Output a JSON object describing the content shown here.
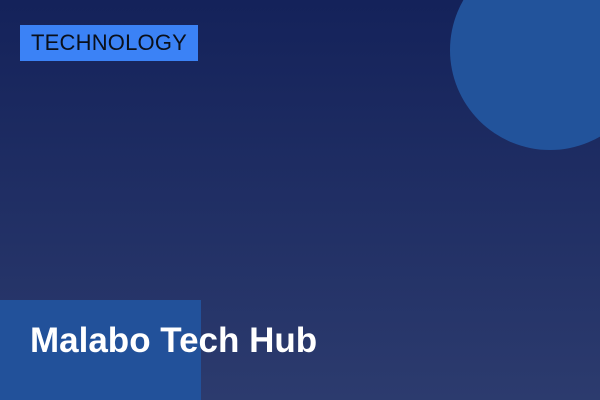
{
  "badge": {
    "label": "TECHNOLOGY"
  },
  "title": "Malabo Tech Hub",
  "colors": {
    "background_top": "#14225a",
    "background_bottom": "#2c3b6e",
    "accent": "#3b82f6",
    "shape": "#22539b",
    "title_text": "#ffffff"
  }
}
